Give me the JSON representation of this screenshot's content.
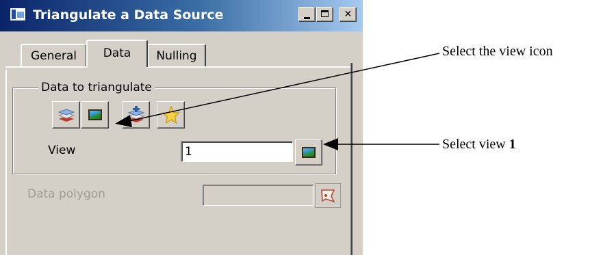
{
  "window": {
    "title": "Triangulate a Data Source",
    "controls": [
      "minimize-icon",
      "maximize-icon",
      "close-icon"
    ],
    "close_glyph": "✕"
  },
  "tabs": [
    {
      "label": "General",
      "selected": false
    },
    {
      "label": "Data",
      "selected": true
    },
    {
      "label": "Nulling",
      "selected": false
    }
  ],
  "data_group": {
    "legend": "Data to triangulate",
    "tool_buttons": [
      "layers-icon",
      "view-icon",
      "layers-add-icon",
      "star-icon"
    ],
    "view_label": "View",
    "view_value": "1"
  },
  "data_polygon": {
    "label": "Data polygon",
    "value": "",
    "enabled": false
  },
  "annotations": {
    "select_view_icon": "Select the view icon",
    "select_view_prefix": "Select view ",
    "select_view_number": "1"
  },
  "colors": {
    "title_bar_start": "#0a246a",
    "title_bar_end": "#a6caf0",
    "dialog_face": "#d4d0c8",
    "disabled_text": "#a09c94"
  }
}
